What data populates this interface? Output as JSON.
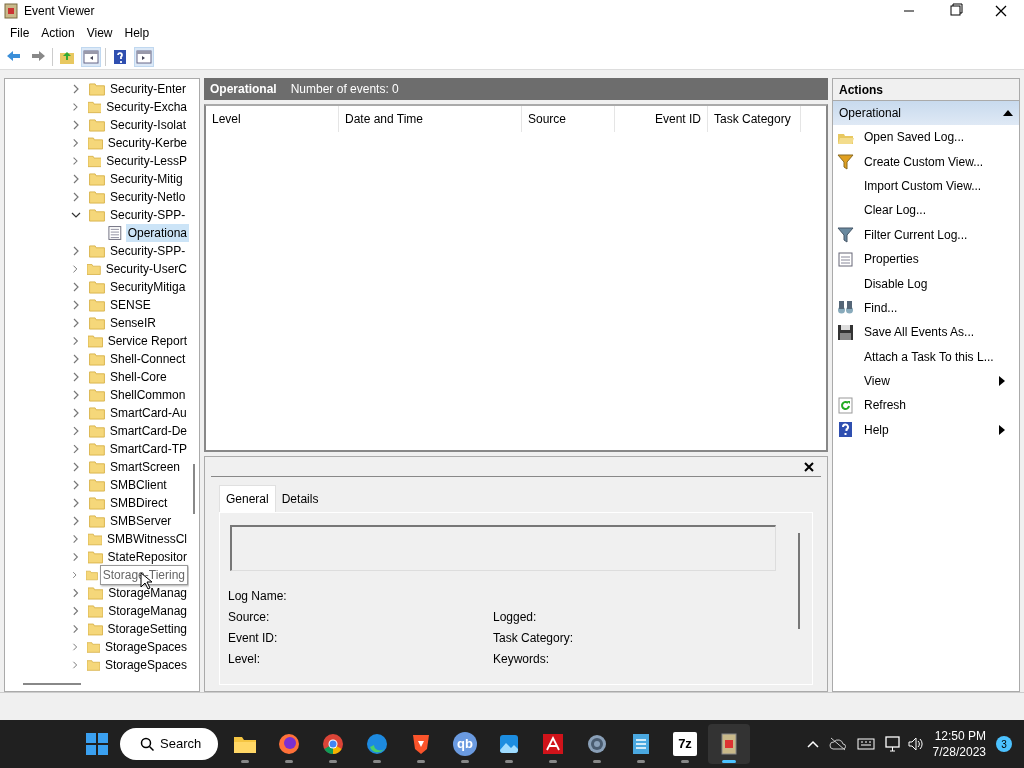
{
  "window": {
    "title": "Event Viewer"
  },
  "menu": [
    "File",
    "Action",
    "View",
    "Help"
  ],
  "toolbar": [
    {
      "kind": "back"
    },
    {
      "kind": "forward"
    },
    {
      "kind": "up"
    },
    {
      "kind": "hide-tree",
      "selected": true
    },
    {
      "kind": "help"
    },
    {
      "kind": "show-actions",
      "selected": true
    }
  ],
  "tree": [
    {
      "label": "Security-Enter",
      "expanded": false
    },
    {
      "label": "Security-Excha",
      "expanded": false
    },
    {
      "label": "Security-Isolat",
      "expanded": false
    },
    {
      "label": "Security-Kerbe",
      "expanded": false
    },
    {
      "label": "Security-LessP",
      "expanded": false
    },
    {
      "label": "Security-Mitig",
      "expanded": false
    },
    {
      "label": "Security-Netlo",
      "expanded": false
    },
    {
      "label": "Security-SPP-",
      "expanded": true,
      "children": [
        {
          "label": "Operationa",
          "selected": true
        }
      ]
    },
    {
      "label": "Security-SPP-",
      "expanded": false
    },
    {
      "label": "Security-UserC",
      "expanded": false
    },
    {
      "label": "SecurityMitiga",
      "expanded": false
    },
    {
      "label": "SENSE",
      "expanded": false
    },
    {
      "label": "SenseIR",
      "expanded": false
    },
    {
      "label": "Service Report",
      "expanded": false
    },
    {
      "label": "Shell-Connect",
      "expanded": false
    },
    {
      "label": "Shell-Core",
      "expanded": false
    },
    {
      "label": "ShellCommon",
      "expanded": false
    },
    {
      "label": "SmartCard-Au",
      "expanded": false
    },
    {
      "label": "SmartCard-De",
      "expanded": false
    },
    {
      "label": "SmartCard-TP",
      "expanded": false
    },
    {
      "label": "SmartScreen",
      "expanded": false
    },
    {
      "label": "SMBClient",
      "expanded": false
    },
    {
      "label": "SMBDirect",
      "expanded": false
    },
    {
      "label": "SMBServer",
      "expanded": false
    },
    {
      "label": "SMBWitnessCl",
      "expanded": false
    },
    {
      "label": "StateRepositor",
      "expanded": false
    },
    {
      "label": "Storage-Tiering",
      "expanded": false,
      "tooltip": true
    },
    {
      "label": "StorageManag",
      "expanded": false
    },
    {
      "label": "StorageManag",
      "expanded": false
    },
    {
      "label": "StorageSetting",
      "expanded": false
    },
    {
      "label": "StorageSpaces",
      "expanded": false
    },
    {
      "label": "StorageSpaces",
      "expanded": false
    }
  ],
  "log_header": {
    "title": "Operational",
    "count": "Number of events: 0"
  },
  "table": {
    "columns": [
      "Level",
      "Date and Time",
      "Source",
      "Event ID",
      "Task Category"
    ]
  },
  "details": {
    "tabs": [
      {
        "label": "General",
        "selected": true
      },
      {
        "label": "Details",
        "selected": false
      }
    ],
    "fields": [
      [
        "Log Name:"
      ],
      [
        "Source:",
        "Logged:"
      ],
      [
        "Event ID:",
        "Task Category:"
      ],
      [
        "Level:",
        "Keywords:"
      ]
    ]
  },
  "actions": {
    "title": "Actions",
    "section": "Operational",
    "items": [
      {
        "label": "Open Saved Log...",
        "kind": "folder"
      },
      {
        "label": "Create Custom View...",
        "kind": "funnel"
      },
      {
        "label": "Import Custom View...",
        "kind": "plain"
      },
      {
        "label": "Clear Log...",
        "kind": "plain"
      },
      {
        "label": "Filter Current Log...",
        "kind": "filter"
      },
      {
        "label": "Properties",
        "kind": "sheet"
      },
      {
        "label": "Disable Log",
        "kind": "plain"
      },
      {
        "label": "Find...",
        "kind": "binoculars"
      },
      {
        "label": "Save All Events As...",
        "kind": "disk"
      },
      {
        "label": "Attach a Task To this L...",
        "kind": "plain"
      },
      {
        "label": "View",
        "kind": "plain",
        "submenu": true
      },
      {
        "label": "Refresh",
        "kind": "refresh"
      },
      {
        "label": "Help",
        "kind": "help",
        "submenu": true
      }
    ]
  },
  "taskbar": {
    "search": "Search",
    "apps": [
      {
        "kind": "folder"
      },
      {
        "kind": "fox"
      },
      {
        "kind": "chrome"
      },
      {
        "kind": "edge"
      },
      {
        "kind": "lion"
      },
      {
        "kind": "text",
        "label": "qb",
        "color": "#6a9ae0"
      },
      {
        "kind": "photos"
      },
      {
        "kind": "acrobat"
      },
      {
        "kind": "gear"
      },
      {
        "kind": "notepad"
      },
      {
        "kind": "text",
        "label": "7z",
        "color": "#ffffff"
      },
      {
        "kind": "viewer",
        "selected": true
      }
    ],
    "time": "12:50 PM",
    "date": "7/28/2023",
    "badge": "3"
  }
}
